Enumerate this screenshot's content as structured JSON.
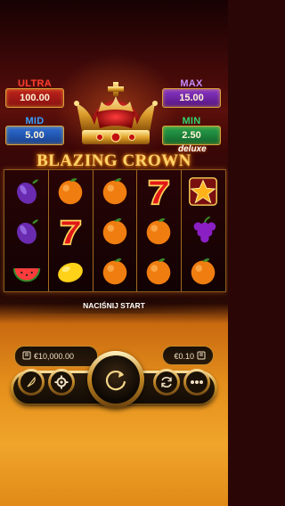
{
  "game": {
    "logo_title": "BLAZING CROWN",
    "logo_suffix": "deluxe"
  },
  "jackpots": {
    "ultra": {
      "label": "ULTRA",
      "value": "100.00"
    },
    "max": {
      "label": "MAX",
      "value": "15.00"
    },
    "mid": {
      "label": "MID",
      "value": "5.00"
    },
    "min": {
      "label": "MIN",
      "value": "2.50"
    }
  },
  "reels": [
    [
      "plum",
      "plum",
      "watermelon"
    ],
    [
      "orange",
      "seven",
      "lemon"
    ],
    [
      "orange",
      "orange",
      "orange"
    ],
    [
      "seven",
      "orange",
      "orange"
    ],
    [
      "star",
      "grapes",
      "orange"
    ]
  ],
  "status": {
    "message": "NACIŚNIJ START"
  },
  "balance": {
    "value": "€10,000.00",
    "icon": "coins-stack-icon"
  },
  "bet": {
    "value": "€0.10",
    "icon": "coins-stack-icon"
  },
  "controls": {
    "left": [
      {
        "name": "feather-icon"
      },
      {
        "name": "settings-gear-icon"
      }
    ],
    "spin": "spin-arrow-icon",
    "right": [
      {
        "name": "autoplay-icon"
      },
      {
        "name": "more-dots-icon"
      }
    ]
  },
  "colors": {
    "ultra": "#c0241c",
    "max": "#8a36c8",
    "mid": "#2d6fd6",
    "min": "#29a34d",
    "gold": "#d9a23a"
  }
}
